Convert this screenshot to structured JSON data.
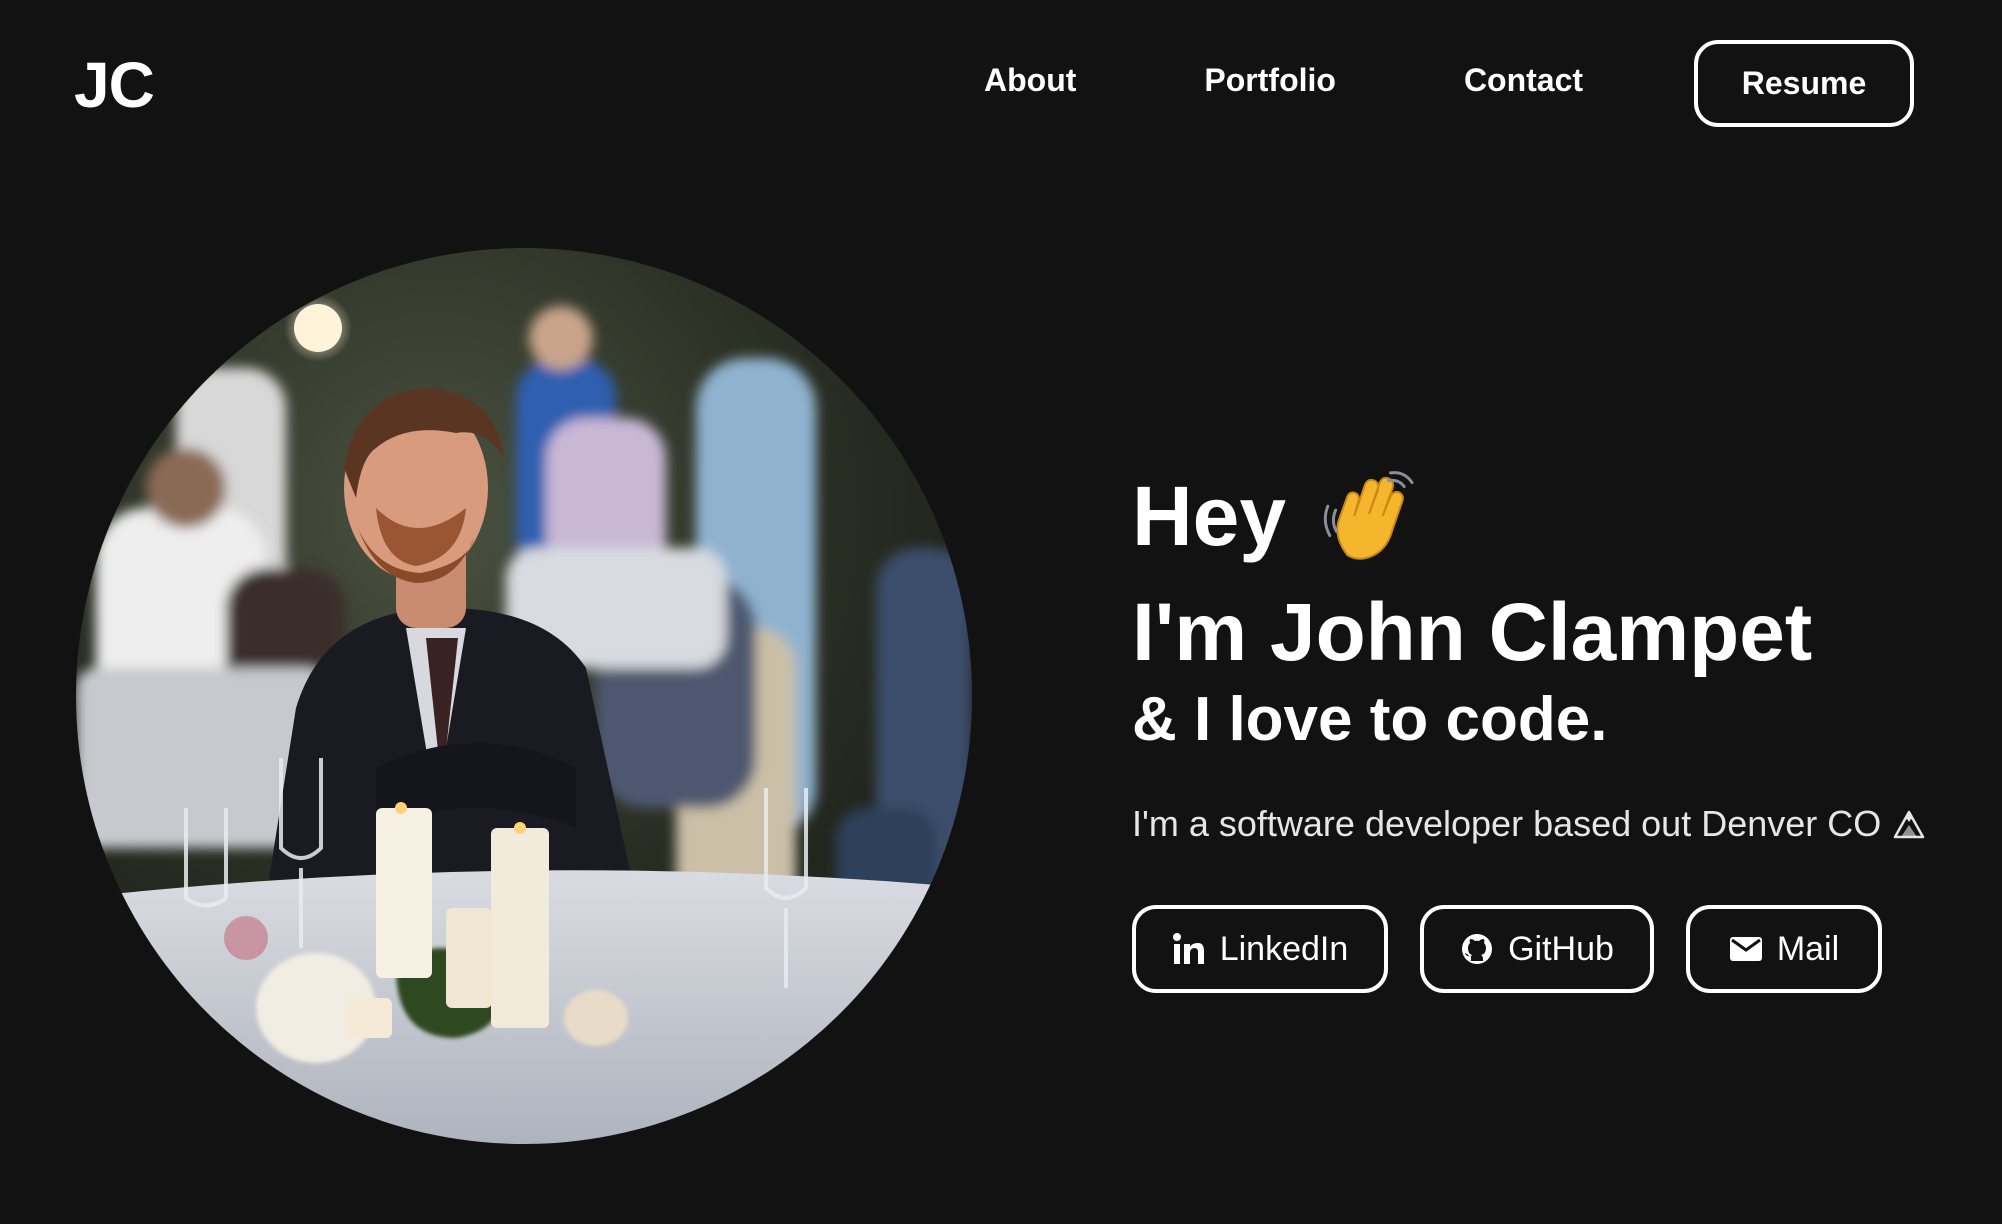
{
  "header": {
    "logo": "JC",
    "nav": [
      {
        "label": "About"
      },
      {
        "label": "Portfolio"
      },
      {
        "label": "Contact"
      }
    ],
    "resume_label": "Resume"
  },
  "hero": {
    "greeting": "Hey",
    "wave_icon": "waving-hand-icon",
    "name_line": "I'm John Clampet",
    "tagline_prefix": "& I love to ",
    "tagline_highlight": "code",
    "tagline_suffix": ".",
    "bio": "I'm a software developer based out Denver CO",
    "bio_icon": "mountain-icon",
    "highlight_color": "#2a1f6e"
  },
  "socials": [
    {
      "label": "LinkedIn",
      "icon": "linkedin-icon"
    },
    {
      "label": "GitHub",
      "icon": "github-icon"
    },
    {
      "label": "Mail",
      "icon": "mail-icon"
    }
  ],
  "photo": {
    "alt_icon": "profile-photo"
  },
  "colors": {
    "background": "#121212",
    "text": "#ffffff"
  }
}
